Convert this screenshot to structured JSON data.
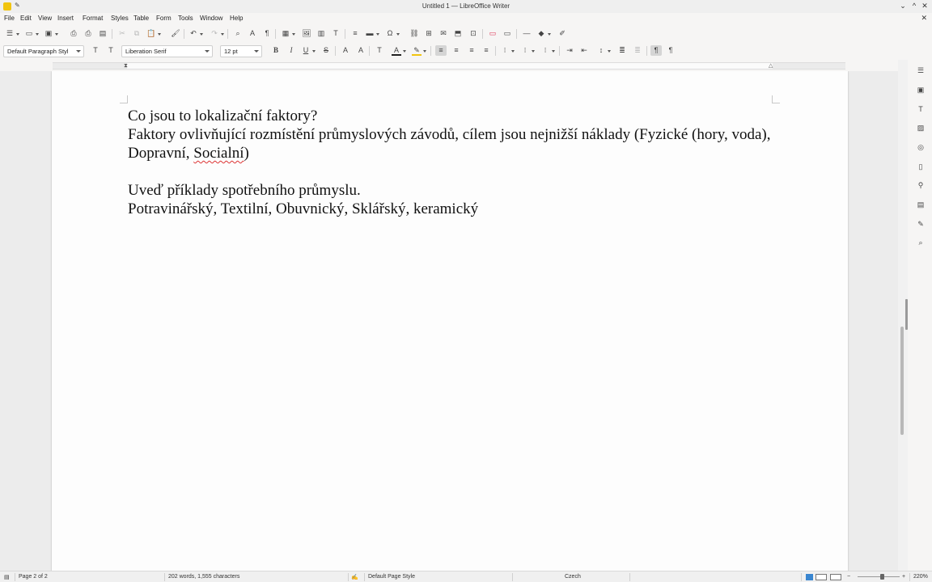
{
  "window": {
    "title": "Untitled 1 — LibreOffice Writer",
    "minimize": "⌄",
    "maximize": "^",
    "close": "✕",
    "doc_close": "✕"
  },
  "menu": [
    "File",
    "Edit",
    "View",
    "Insert",
    "Format",
    "Styles",
    "Table",
    "Form",
    "Tools",
    "Window",
    "Help"
  ],
  "toolbar2": {
    "paragraph_style": "Default Paragraph Styl",
    "font_name": "Liberation Serif",
    "font_size": "12 pt"
  },
  "document": {
    "paragraphs": [
      "Co jsou to lokalizační faktory?",
      "Faktory ovlivňující rozmístění průmyslových závodů, cílem jsou nejnižší náklady (Fyzické (hory, voda), Dopravní, ",
      "",
      "Uveď příklady spotřebního průmyslu.",
      "Potravinářský, Textilní, Obuvnický, Sklářský, keramický"
    ],
    "misspelled_word": "Socialní",
    "after_misspelled": ")"
  },
  "status": {
    "page": "Page 2 of 2",
    "words": "202 words, 1,555 characters",
    "page_style": "Default Page Style",
    "language": "Czech",
    "zoom_minus": "−",
    "zoom_plus": "+",
    "zoom": "220%"
  },
  "colors": {
    "font_color_bar": "#c0392b",
    "highlight_bar": "#f1c40f",
    "app_icon": "#f1c40f",
    "spell_underline": "#d33"
  }
}
